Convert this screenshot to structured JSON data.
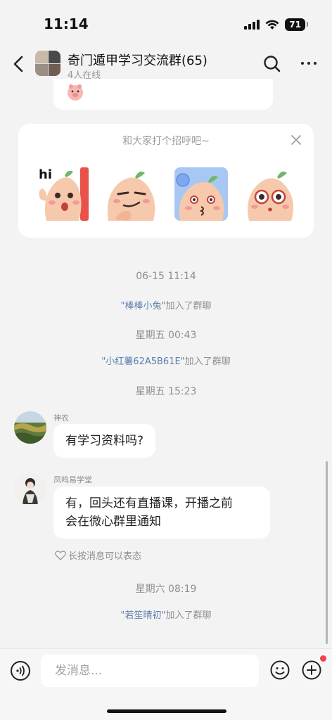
{
  "status_bar": {
    "time": "11:14",
    "battery": "71"
  },
  "header": {
    "title": "奇门遁甲学习交流群(65)",
    "subtitle": "4人在线"
  },
  "greeting_card": {
    "title": "和大家打个招呼吧~",
    "stickers": [
      "hi-peach-sticker",
      "smirk-peach-sticker",
      "kiss-peach-sticker",
      "stare-peach-sticker"
    ],
    "sticker_text": "hi"
  },
  "timeline": {
    "time1": "06-15 11:14",
    "join1": {
      "user": "\"棒棒小兔\"",
      "suffix": "加入了群聊"
    },
    "time2": "星期五 00:43",
    "join2": {
      "user": "\"小红薯62A5B61E\"",
      "suffix": "加入了群聊"
    },
    "time3": "星期五 15:23",
    "msg1": {
      "sender": "神农",
      "text": "有学习资料吗?"
    },
    "msg2": {
      "sender": "凤鸣易学堂",
      "line1": "有，回头还有直播课，开播之前",
      "line2": "会在微心群里通知"
    },
    "hint": "长按消息可以表态",
    "time4": "星期六 08:19",
    "join3": {
      "user": "\"若笙晴初\"",
      "suffix": "加入了群聊"
    }
  },
  "input_bar": {
    "placeholder": "发消息..."
  },
  "colors": {
    "link": "#5b7fb0",
    "background": "#f3f3f3",
    "badge": "#f0414b"
  }
}
